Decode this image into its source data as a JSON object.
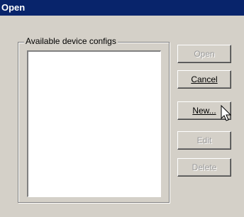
{
  "window": {
    "title": "Open"
  },
  "group": {
    "label": "Available device configs",
    "items": []
  },
  "buttons": {
    "open": {
      "label": "Open",
      "enabled": false
    },
    "cancel": {
      "label": "Cancel",
      "enabled": true
    },
    "new": {
      "label": "New...",
      "enabled": true
    },
    "edit": {
      "label": "Edit",
      "enabled": false
    },
    "delete": {
      "label": "Delete",
      "enabled": false
    }
  },
  "icons": {
    "cursor": "arrow-pointer-icon"
  }
}
